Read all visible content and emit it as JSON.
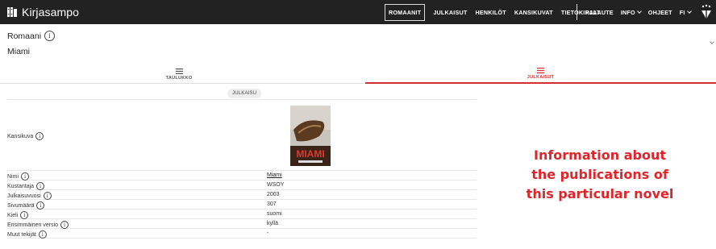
{
  "header": {
    "brand": "Kirjasampo",
    "nav_primary": [
      {
        "label": "ROMAANIT",
        "active": true
      },
      {
        "label": "JULKAISUT",
        "active": false
      },
      {
        "label": "HENKILÖT",
        "active": false
      },
      {
        "label": "KANSIKUVAT",
        "active": false
      },
      {
        "label": "TIETOKIRJAT",
        "active": false
      }
    ],
    "nav_secondary": [
      "PALAUTE",
      "INFO",
      "OHJEET",
      "FI"
    ]
  },
  "page": {
    "title": "Romaani",
    "info_glyph": "i",
    "work_name": "Miami"
  },
  "tabs": [
    {
      "label": "TAULUKKO",
      "icon": "table-icon",
      "active": false
    },
    {
      "label": "JULKAISUT",
      "icon": "list-icon",
      "active": true
    }
  ],
  "publication": {
    "header": "JULKAISU",
    "cover_label": "Kansikuva",
    "cover_title": "MIAMI",
    "fields": [
      {
        "label": "Nimi",
        "value": "Miami"
      },
      {
        "label": "Kustantaja",
        "value": "WSOY"
      },
      {
        "label": "Julkaisuvuosi",
        "value": "2003"
      },
      {
        "label": "Sivumäärä",
        "value": "307"
      },
      {
        "label": "Kieli",
        "value": "suomi"
      },
      {
        "label": "Ensimmäinen versio",
        "value": "kyllä"
      },
      {
        "label": "Muut tekijät",
        "value": "-"
      }
    ]
  },
  "annotation": {
    "lines": [
      "Information about",
      "the publications of",
      "this particular novel"
    ]
  },
  "colors": {
    "topbar": "#222222",
    "accent": "#d32f2f",
    "annotation": "#e0242a"
  }
}
